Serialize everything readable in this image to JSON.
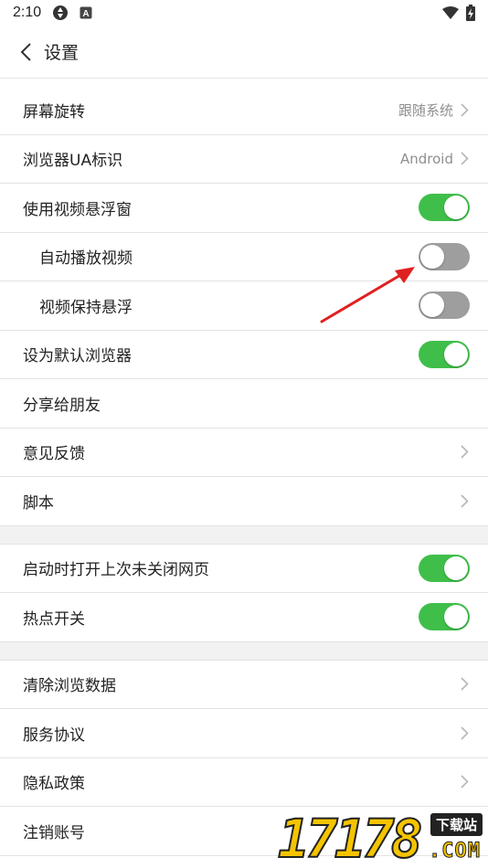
{
  "status_bar": {
    "time": "2:10",
    "icons": [
      "sync-icon",
      "a-badge-icon"
    ],
    "right_icons": [
      "wifi-icon",
      "battery-charging-icon"
    ]
  },
  "header": {
    "title": "设置",
    "back_icon": "chevron-left-icon"
  },
  "sections": [
    {
      "items": [
        {
          "label": "屏幕旋转",
          "type": "value",
          "value": "跟随系统"
        },
        {
          "label": "浏览器UA标识",
          "type": "value",
          "value": "Android"
        },
        {
          "label": "使用视频悬浮窗",
          "type": "toggle",
          "on": true
        },
        {
          "label": "自动播放视频",
          "type": "toggle",
          "on": false,
          "indent": true
        },
        {
          "label": "视频保持悬浮",
          "type": "toggle",
          "on": false,
          "indent": true
        },
        {
          "label": "设为默认浏览器",
          "type": "toggle",
          "on": true
        },
        {
          "label": "分享给朋友",
          "type": "plain"
        },
        {
          "label": "意见反馈",
          "type": "chevron"
        },
        {
          "label": "脚本",
          "type": "chevron"
        }
      ]
    },
    {
      "items": [
        {
          "label": "启动时打开上次未关闭网页",
          "type": "toggle",
          "on": true
        },
        {
          "label": "热点开关",
          "type": "toggle",
          "on": true
        }
      ]
    },
    {
      "items": [
        {
          "label": "清除浏览数据",
          "type": "chevron"
        },
        {
          "label": "服务协议",
          "type": "chevron"
        },
        {
          "label": "隐私政策",
          "type": "chevron"
        },
        {
          "label": "注销账号",
          "type": "plain"
        }
      ]
    }
  ],
  "colors": {
    "toggle_on": "#3fbf4a",
    "toggle_off": "#9e9e9e",
    "annotation_arrow": "#e02020",
    "section_gap": "#f2f2f2"
  },
  "watermark": {
    "number": "17178",
    "badge": "下载站",
    "suffix": ".COM"
  }
}
